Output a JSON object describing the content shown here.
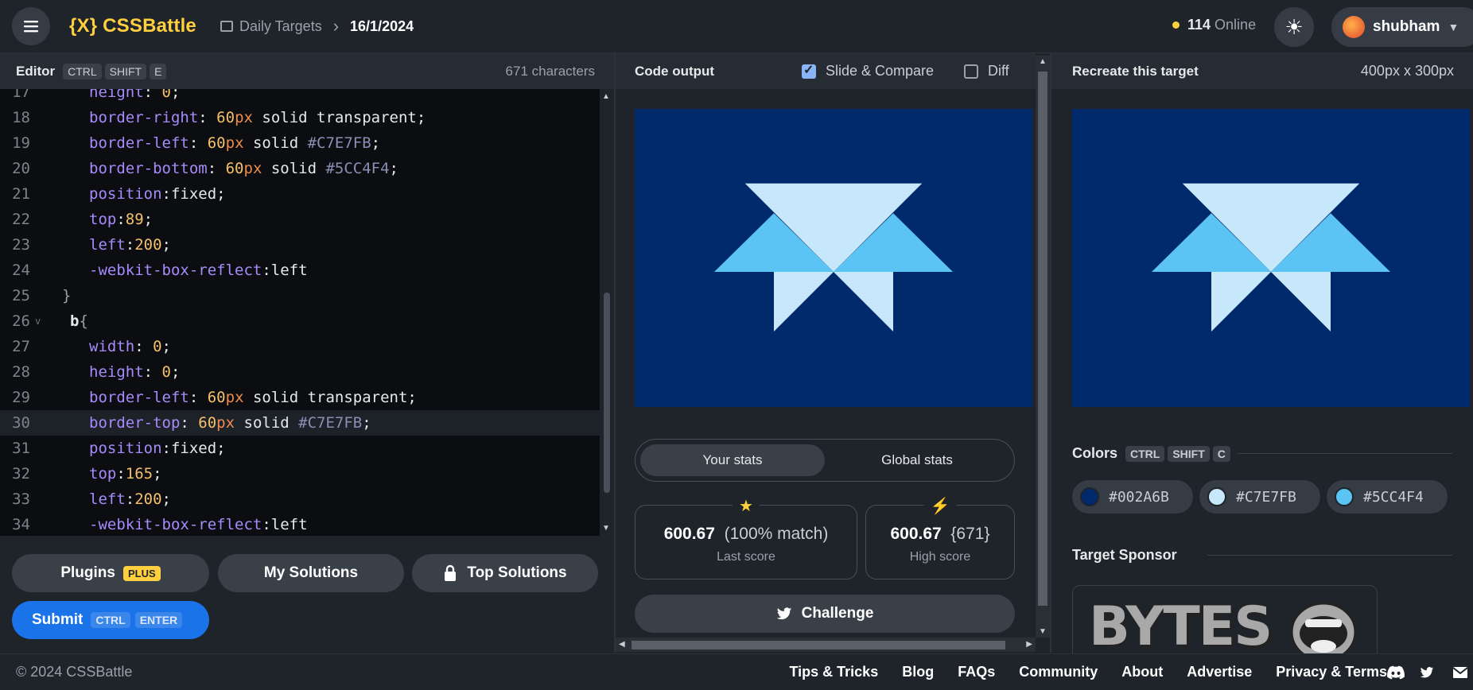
{
  "header": {
    "logo": "{X} CSSBattle",
    "breadcrumb_root": "Daily Targets",
    "breadcrumb_date": "16/1/2024",
    "online_count": "114",
    "online_label": "Online",
    "username": "shubham"
  },
  "editor": {
    "title": "Editor",
    "shortcut_keys": [
      "CTRL",
      "SHIFT",
      "E"
    ],
    "char_count": "671 characters",
    "lines": [
      {
        "n": "17",
        "parts": [
          [
            "p",
            "height"
          ],
          [
            "pn",
            ": "
          ],
          [
            "n",
            "0"
          ],
          [
            "pn",
            ";"
          ]
        ]
      },
      {
        "n": "18",
        "parts": [
          [
            "p",
            "border-right"
          ],
          [
            "pn",
            ": "
          ],
          [
            "n",
            "60"
          ],
          [
            "u",
            "px"
          ],
          [
            "k",
            " solid transparent"
          ],
          [
            "pn",
            ";"
          ]
        ]
      },
      {
        "n": "19",
        "parts": [
          [
            "p",
            "border-left"
          ],
          [
            "pn",
            ": "
          ],
          [
            "n",
            "60"
          ],
          [
            "u",
            "px"
          ],
          [
            "k",
            " solid "
          ],
          [
            "h",
            "#C7E7FB"
          ],
          [
            "pn",
            ";"
          ]
        ]
      },
      {
        "n": "20",
        "parts": [
          [
            "p",
            "border-bottom"
          ],
          [
            "pn",
            ": "
          ],
          [
            "n",
            "60"
          ],
          [
            "u",
            "px"
          ],
          [
            "k",
            " solid "
          ],
          [
            "h",
            "#5CC4F4"
          ],
          [
            "pn",
            ";"
          ]
        ]
      },
      {
        "n": "21",
        "parts": [
          [
            "p",
            "position"
          ],
          [
            "pn",
            ":"
          ],
          [
            "k",
            "fixed"
          ],
          [
            "pn",
            ";"
          ]
        ]
      },
      {
        "n": "22",
        "parts": [
          [
            "p",
            "top"
          ],
          [
            "pn",
            ":"
          ],
          [
            "n",
            "89"
          ],
          [
            "pn",
            ";"
          ]
        ]
      },
      {
        "n": "23",
        "parts": [
          [
            "p",
            "left"
          ],
          [
            "pn",
            ":"
          ],
          [
            "n",
            "200"
          ],
          [
            "pn",
            ";"
          ]
        ]
      },
      {
        "n": "24",
        "parts": [
          [
            "p",
            "-webkit-box-reflect"
          ],
          [
            "pn",
            ":"
          ],
          [
            "k",
            "left"
          ]
        ]
      },
      {
        "n": "25",
        "parts": [
          [
            "br",
            "}"
          ]
        ],
        "indent": "outer"
      },
      {
        "n": "26",
        "parts": [
          [
            "sel",
            "b"
          ],
          [
            "br",
            "{"
          ]
        ],
        "indent": "sel",
        "fold": true
      },
      {
        "n": "27",
        "parts": [
          [
            "p",
            "width"
          ],
          [
            "pn",
            ": "
          ],
          [
            "n",
            "0"
          ],
          [
            "pn",
            ";"
          ]
        ]
      },
      {
        "n": "28",
        "parts": [
          [
            "p",
            "height"
          ],
          [
            "pn",
            ": "
          ],
          [
            "n",
            "0"
          ],
          [
            "pn",
            ";"
          ]
        ]
      },
      {
        "n": "29",
        "parts": [
          [
            "p",
            "border-left"
          ],
          [
            "pn",
            ": "
          ],
          [
            "n",
            "60"
          ],
          [
            "u",
            "px"
          ],
          [
            "k",
            " solid transparent"
          ],
          [
            "pn",
            ";"
          ]
        ]
      },
      {
        "n": "30",
        "parts": [
          [
            "p",
            "border-top"
          ],
          [
            "pn",
            ": "
          ],
          [
            "n",
            "60"
          ],
          [
            "u",
            "px"
          ],
          [
            "k",
            " solid "
          ],
          [
            "h",
            "#C7E7FB"
          ],
          [
            "pn",
            ";"
          ]
        ],
        "active": true
      },
      {
        "n": "31",
        "parts": [
          [
            "p",
            "position"
          ],
          [
            "pn",
            ":"
          ],
          [
            "k",
            "fixed"
          ],
          [
            "pn",
            ";"
          ]
        ]
      },
      {
        "n": "32",
        "parts": [
          [
            "p",
            "top"
          ],
          [
            "pn",
            ":"
          ],
          [
            "n",
            "165"
          ],
          [
            "pn",
            ";"
          ]
        ]
      },
      {
        "n": "33",
        "parts": [
          [
            "p",
            "left"
          ],
          [
            "pn",
            ":"
          ],
          [
            "n",
            "200"
          ],
          [
            "pn",
            ";"
          ]
        ]
      },
      {
        "n": "34",
        "parts": [
          [
            "p",
            "-webkit-box-reflect"
          ],
          [
            "pn",
            ":"
          ],
          [
            "k",
            "left"
          ]
        ]
      }
    ],
    "plugins_label": "Plugins",
    "plugins_badge": "PLUS",
    "my_solutions_label": "My Solutions",
    "top_solutions_label": "Top Solutions",
    "submit_label": "Submit",
    "submit_keys": [
      "CTRL",
      "ENTER"
    ]
  },
  "output": {
    "title": "Code output",
    "slide_compare_label": "Slide & Compare",
    "slide_compare_checked": true,
    "diff_label": "Diff",
    "diff_checked": false,
    "tab_your_stats": "Your stats",
    "tab_global_stats": "Global stats",
    "last_score_value": "600.67",
    "last_score_detail": "(100% match)",
    "last_score_label": "Last score",
    "high_score_value": "600.67",
    "high_score_detail": "{671}",
    "high_score_label": "High score",
    "challenge_label": "Challenge"
  },
  "target": {
    "title": "Recreate this target",
    "dimensions": "400px x 300px",
    "colors_title": "Colors",
    "colors_keys": [
      "CTRL",
      "SHIFT",
      "C"
    ],
    "colors": [
      {
        "hex": "#002A6B"
      },
      {
        "hex": "#C7E7FB"
      },
      {
        "hex": "#5CC4F4"
      }
    ],
    "sponsor_title": "Target Sponsor",
    "sponsor_logo": "BYTES"
  },
  "palette": {
    "bg": "#002A6B",
    "light": "#C7E7FB",
    "mid": "#5CC4F4"
  },
  "footer": {
    "copyright": "© 2024 CSSBattle",
    "links": [
      "Tips & Tricks",
      "Blog",
      "FAQs",
      "Community",
      "About",
      "Advertise",
      "Privacy & Terms"
    ]
  }
}
